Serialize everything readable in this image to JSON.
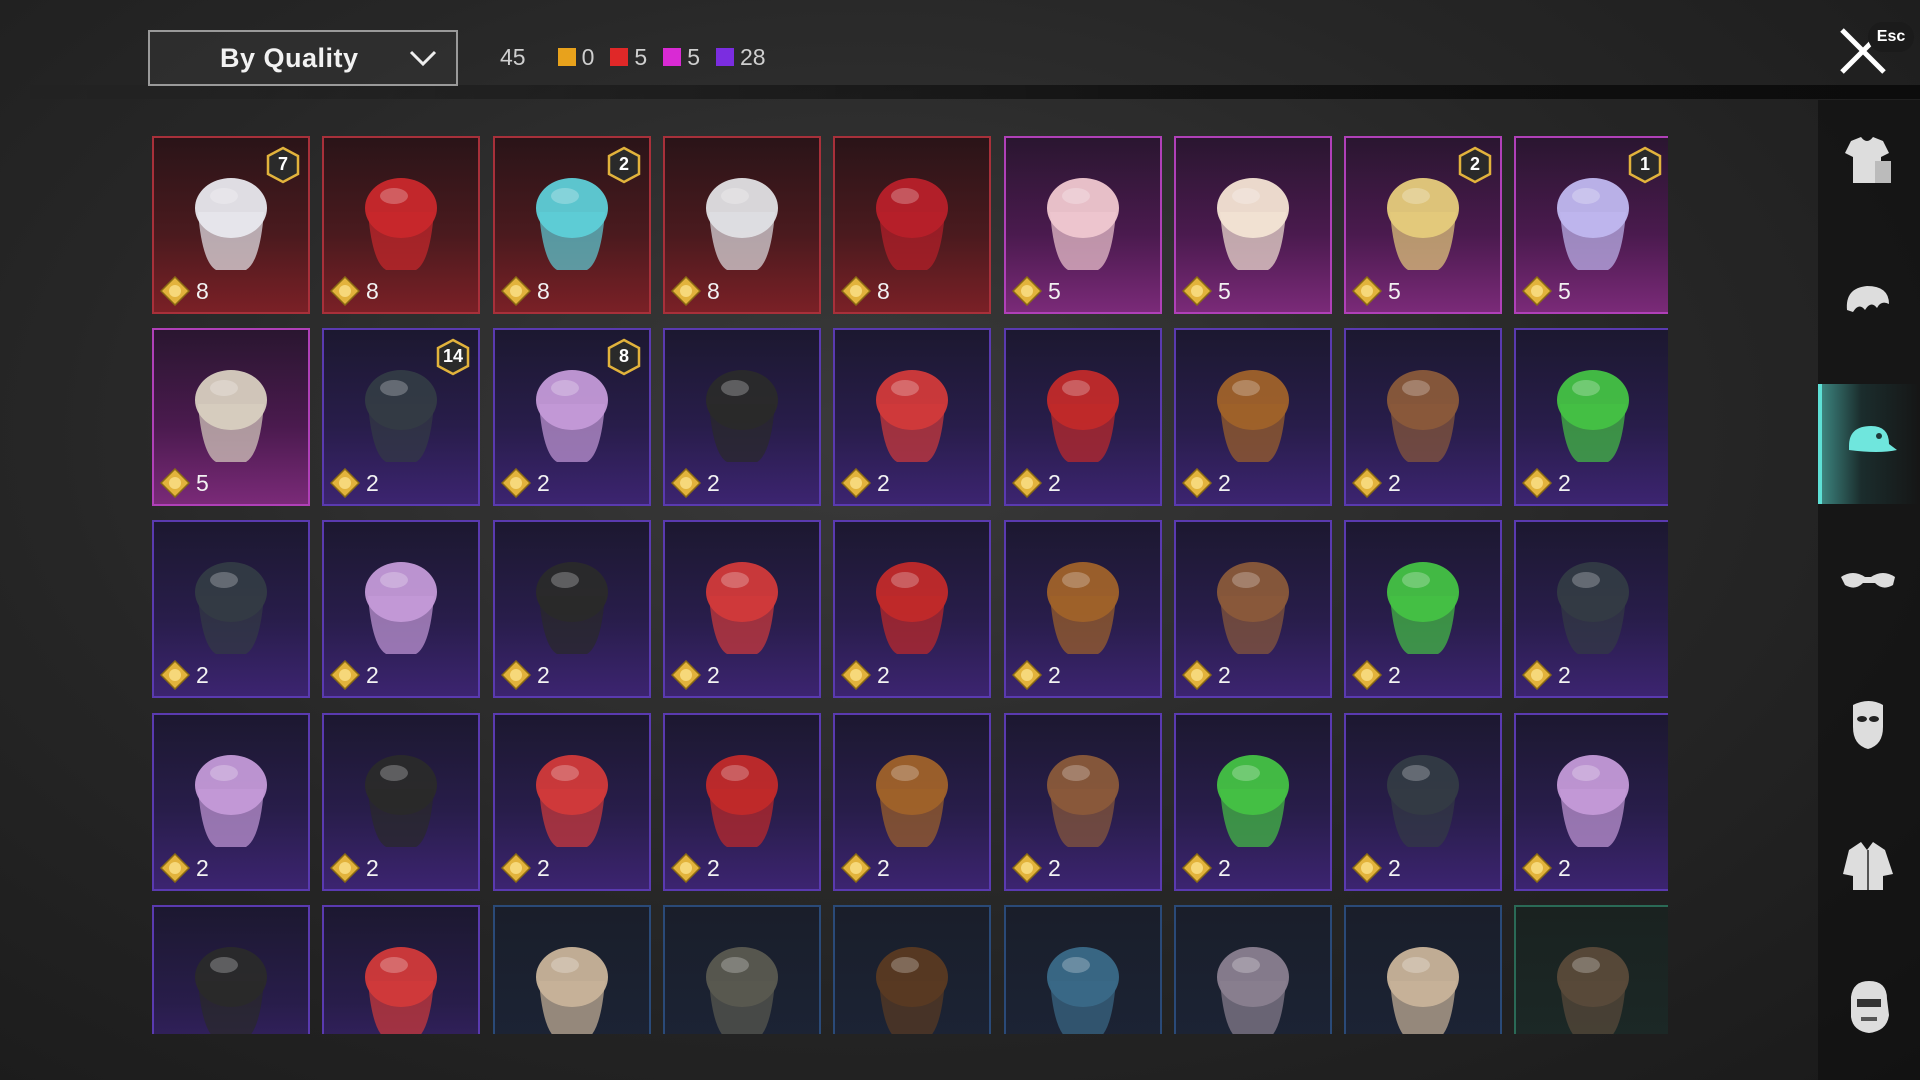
{
  "sort_dropdown": {
    "label": "By Quality"
  },
  "counts": {
    "total": "45",
    "by_quality": [
      {
        "color": "#e8a21c",
        "value": "0"
      },
      {
        "color": "#e02828",
        "value": "5"
      },
      {
        "color": "#d92ad4",
        "value": "5"
      },
      {
        "color": "#7b2de0",
        "value": "28"
      }
    ]
  },
  "close": {
    "esc_label": "Esc"
  },
  "categories": [
    {
      "icon": "outfit-icon",
      "active": false
    },
    {
      "icon": "hair-icon",
      "active": false
    },
    {
      "icon": "cap-icon",
      "active": true
    },
    {
      "icon": "glasses-icon",
      "active": false
    },
    {
      "icon": "mask-icon",
      "active": false
    },
    {
      "icon": "jacket-icon",
      "active": false
    },
    {
      "icon": "face-icon",
      "active": false
    }
  ],
  "items": [
    {
      "icon": "white-hair-wig-icon",
      "quality": "red",
      "price": "8",
      "badge": "7"
    },
    {
      "icon": "red-helmet-icon",
      "quality": "red",
      "price": "8",
      "badge": ""
    },
    {
      "icon": "teal-jellyfish-hat-icon",
      "quality": "red",
      "price": "8",
      "badge": "2"
    },
    {
      "icon": "crowned-shark-hood-icon",
      "quality": "red",
      "price": "8",
      "badge": ""
    },
    {
      "icon": "red-mecha-helmet-icon",
      "quality": "red",
      "price": "8",
      "badge": ""
    },
    {
      "icon": "pastel-pigtails-icon",
      "quality": "pink",
      "price": "5",
      "badge": ""
    },
    {
      "icon": "lion-dance-hood-icon",
      "quality": "pink",
      "price": "5",
      "badge": ""
    },
    {
      "icon": "blonde-headwrap-icon",
      "quality": "pink",
      "price": "5",
      "badge": "2"
    },
    {
      "icon": "silver-twintails-icon",
      "quality": "pink",
      "price": "5",
      "badge": "1"
    },
    {
      "icon": "lion-dreadlocks-icon",
      "quality": "pink",
      "price": "5",
      "badge": ""
    },
    {
      "icon": "cat-cap-long-hair-icon",
      "quality": "purple",
      "price": "2",
      "badge": "14"
    },
    {
      "icon": "green-skull-hood-icon",
      "quality": "purple",
      "price": "2",
      "badge": "8"
    },
    {
      "icon": "gold-visor-helmet-icon",
      "quality": "purple",
      "price": "2",
      "badge": ""
    },
    {
      "icon": "colorful-beanie-icon",
      "quality": "purple",
      "price": "2",
      "badge": ""
    },
    {
      "icon": "black-braids-icon",
      "quality": "purple",
      "price": "2",
      "badge": ""
    },
    {
      "icon": "red-cat-ears-icon",
      "quality": "purple",
      "price": "2",
      "badge": ""
    },
    {
      "icon": "red-gold-cap-icon",
      "quality": "purple",
      "price": "2",
      "badge": ""
    },
    {
      "icon": "brown-horse-hair-icon",
      "quality": "purple",
      "price": "2",
      "badge": ""
    },
    {
      "icon": "red-mohawk-icon",
      "quality": "purple",
      "price": "2",
      "badge": ""
    },
    {
      "icon": "sombrero-icon",
      "quality": "purple",
      "price": "2",
      "badge": ""
    },
    {
      "icon": "steampunk-hat-icon",
      "quality": "purple",
      "price": "2",
      "badge": ""
    },
    {
      "icon": "orange-hair-helmet-icon",
      "quality": "purple",
      "price": "2",
      "badge": ""
    },
    {
      "icon": "gas-mask-hood-icon",
      "quality": "purple",
      "price": "2",
      "badge": ""
    },
    {
      "icon": "bunny-ears-headband-icon",
      "quality": "purple",
      "price": "2",
      "badge": ""
    },
    {
      "icon": "goggles-hood-icon",
      "quality": "purple",
      "price": "2",
      "badge": ""
    },
    {
      "icon": "gray-motorcycle-helmet-icon",
      "quality": "purple",
      "price": "2",
      "badge": ""
    },
    {
      "icon": "blue-shark-hat-icon",
      "quality": "purple",
      "price": "2",
      "badge": ""
    },
    {
      "icon": "red-beret-icon",
      "quality": "purple",
      "price": "2",
      "badge": ""
    },
    {
      "icon": "black-fedora-icon",
      "quality": "purple",
      "price": "2",
      "badge": ""
    },
    {
      "icon": "white-shark-hat-icon",
      "quality": "purple",
      "price": "2",
      "badge": ""
    },
    {
      "icon": "red-bucket-hat-icon",
      "quality": "purple",
      "price": "2",
      "badge": ""
    },
    {
      "icon": "cupcake-hat-icon",
      "quality": "purple",
      "price": "2",
      "badge": ""
    },
    {
      "icon": "head-mirror-icon",
      "quality": "purple",
      "price": "2",
      "badge": ""
    },
    {
      "icon": "blue-cap-icon",
      "quality": "purple",
      "price": "2",
      "badge": ""
    },
    {
      "icon": "maroon-fedora-icon",
      "quality": "purple",
      "price": "2",
      "badge": ""
    },
    {
      "icon": "checkered-bandana-icon",
      "quality": "purple",
      "price": "2",
      "badge": ""
    },
    {
      "icon": "black-bucket-hat-icon",
      "quality": "purple",
      "price": "",
      "badge": ""
    },
    {
      "icon": "aviator-helmet-icon",
      "quality": "purple",
      "price": "",
      "badge": ""
    },
    {
      "icon": "brown-hair-icon",
      "quality": "blue",
      "price": "",
      "badge": ""
    },
    {
      "icon": "blue-beret-icon",
      "quality": "blue",
      "price": "",
      "badge": ""
    },
    {
      "icon": "gray-beret-icon",
      "quality": "blue",
      "price": "",
      "badge": ""
    },
    {
      "icon": "trucker-cap-red-icon",
      "quality": "blue",
      "price": "",
      "badge": ""
    },
    {
      "icon": "trucker-cap-blue-icon",
      "quality": "blue",
      "price": "",
      "badge": ""
    },
    {
      "icon": "camo-helmet-icon",
      "quality": "blue",
      "price": "",
      "badge": ""
    },
    {
      "icon": "brown-cap-icon",
      "quality": "green",
      "price": "",
      "badge": ""
    }
  ],
  "colors": {
    "accent_teal": "#5ee0d6",
    "coin_gold": "#e2b33c"
  }
}
